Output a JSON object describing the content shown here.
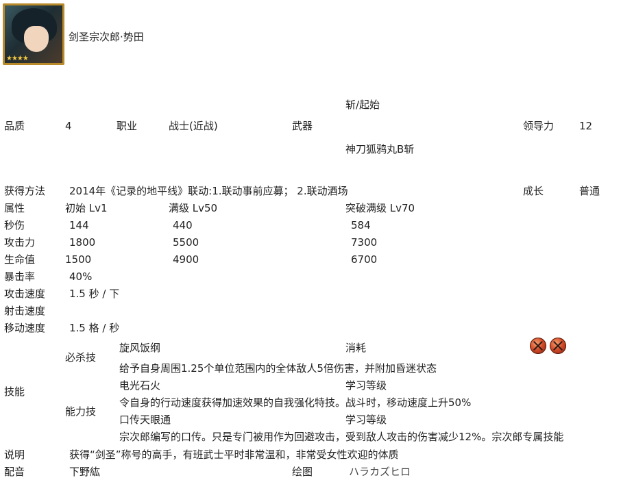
{
  "header": {
    "name": "剑圣宗次郎·势田",
    "rarity_stars": "★★★★"
  },
  "row1": {
    "quality_label": "品质",
    "quality_value": "4",
    "class_label": "职业",
    "class_value": "战士(近战)",
    "weapon_label": "武器",
    "weapon_skill": "斩/起始",
    "weapon_name": "神刀狐鸦丸B斩",
    "leadership_label": "领导力",
    "leadership_value": "12"
  },
  "obtain": {
    "label": "获得方法",
    "value": "2014年《记录的地平线》联动:1.联动事前应募； 2.联动酒场",
    "growth_label": "成长",
    "growth_value": "普通"
  },
  "stats": {
    "header": [
      "属性",
      "初始 Lv1",
      "满级 Lv50",
      "突破满级 Lv70"
    ],
    "rows": [
      {
        "label": "秒伤",
        "v1": "144",
        "v2": "440",
        "v3": "584"
      },
      {
        "label": "攻击力",
        "v1": "1800",
        "v2": "5500",
        "v3": "7300"
      },
      {
        "label": "生命值",
        "v1": "1500",
        "v2": "4900",
        "v3": "6700"
      }
    ],
    "crit_label": "暴击率",
    "crit_value": "40%",
    "atk_speed_label": "攻击速度",
    "atk_speed_value": "1.5 秒 / 下",
    "shoot_speed_label": "射击速度",
    "shoot_speed_value": "",
    "move_speed_label": "移动速度",
    "move_speed_value": "1.5 格 / 秒"
  },
  "skills": {
    "label": "技能",
    "special_label": "必杀技",
    "special_name": "旋风饭纲",
    "special_cost_label": "消耗",
    "special_cost_icon": "orb-cost-icon",
    "special_desc": "给予自身周围1.25个单位范围内的全体敌人5倍伤害，并附加昏迷状态",
    "ability_label": "能力技",
    "ability1_name": "电光石火",
    "ability1_level_label": "学习等级",
    "ability1_desc": "令自身的行动速度获得加速效果的自我强化特技。战斗时，移动速度上升50%",
    "ability2_name": "口传天眼通",
    "ability2_level_label": "学习等级",
    "ability2_desc": "宗次郎编写的口传。只是专门被用作为回避攻击，受到敌人攻击的伤害减少12%。宗次郎专属技能"
  },
  "footer": {
    "desc_label": "说明",
    "desc_value": "获得“剑圣”称号的高手，有班武士平时非常温和，非常受女性欢迎的体质",
    "voice_label": "配音",
    "voice_value": "下野紘",
    "art_label": "绘图",
    "art_value": "ハラカズヒロ"
  },
  "colors": {
    "text": "#222222",
    "frame_gold": "#b88a2a",
    "cost_orb": "#d24a28"
  }
}
